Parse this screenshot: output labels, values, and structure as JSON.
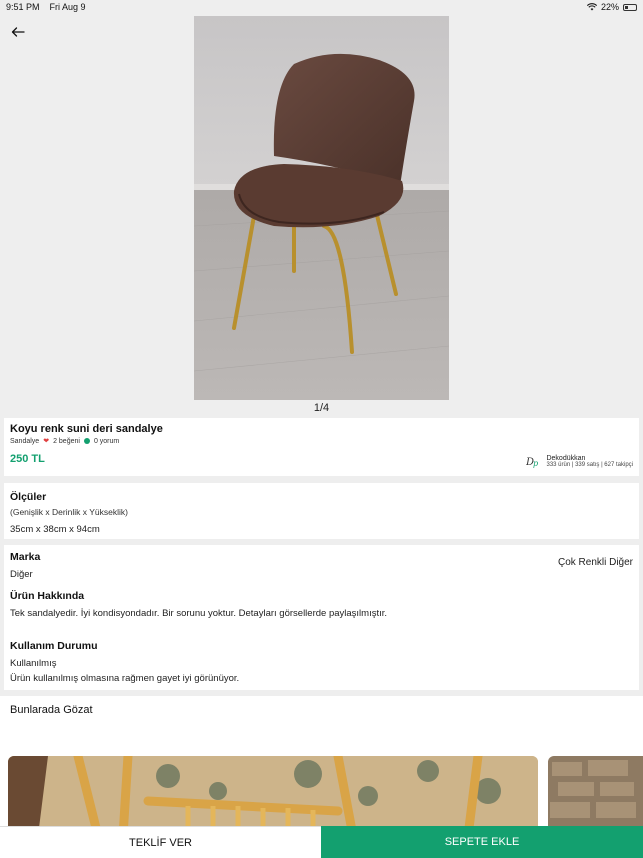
{
  "status_bar": {
    "time": "9:51 PM",
    "date": "Fri Aug 9",
    "battery": "22%"
  },
  "image": {
    "counter": "1/4"
  },
  "product": {
    "title": "Koyu renk suni deri sandalye",
    "category": "Sandalye",
    "likes": "2 beğeni",
    "comments": "0 yorum",
    "price": "250 TL"
  },
  "seller": {
    "name": "Dekodükkan",
    "stats": "333 ürün | 339 satış | 627 takipçi"
  },
  "dimensions": {
    "title": "Ölçüler",
    "subtitle": "(Genişlik x Derinlik x Yükseklik)",
    "value": "35cm x 38cm x 94cm"
  },
  "details": {
    "brand_label": "Marka",
    "brand_value": "Diğer",
    "color_value": "Çok Renkli Diğer",
    "about_label": "Ürün Hakkında",
    "about_text": "Tek sandalyedir. İyi kondisyondadır. Bir sorunu yoktur. Detayları görsellerde paylaşılmıştır.",
    "usage_label": "Kullanım Durumu",
    "usage_value": "Kullanılmış",
    "usage_text": "Ürün kullanılmış olmasına rağmen gayet iyi görünüyor."
  },
  "browse": {
    "title": "Bunlarada Gözat"
  },
  "actions": {
    "offer_label": "TEKLİF VER",
    "cart_label": "SEPETE EKLE"
  },
  "colors": {
    "accent": "#13a06f",
    "heart": "#e04040"
  }
}
